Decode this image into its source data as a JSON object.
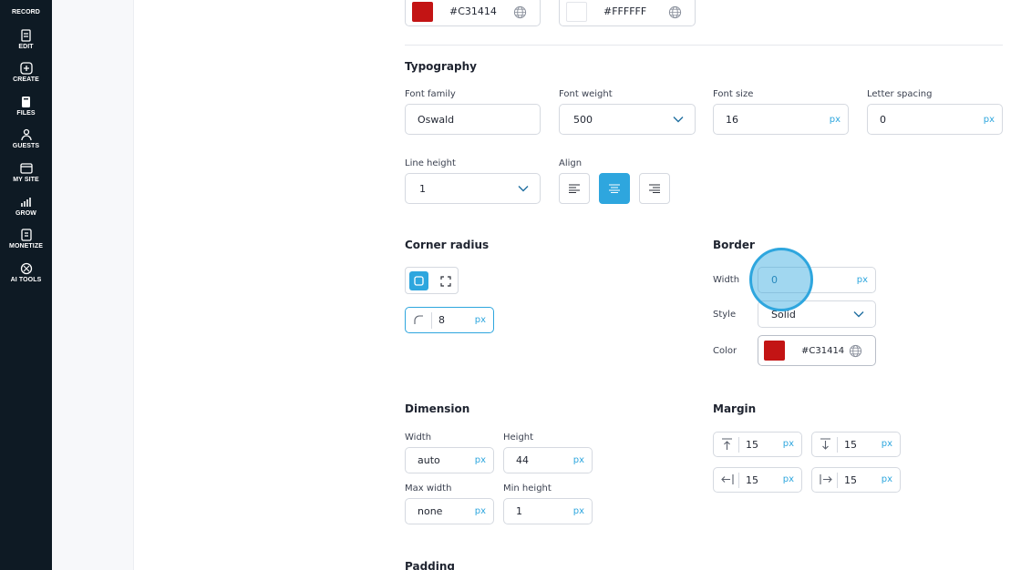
{
  "sidebar": {
    "items": [
      {
        "label": "RECORD",
        "icon": "record-icon"
      },
      {
        "label": "EDIT",
        "icon": "edit-icon"
      },
      {
        "label": "CREATE",
        "icon": "create-icon"
      },
      {
        "label": "FILES",
        "icon": "files-icon"
      },
      {
        "label": "GUESTS",
        "icon": "guests-icon"
      },
      {
        "label": "MY SITE",
        "icon": "my-site-icon"
      },
      {
        "label": "GROW",
        "icon": "grow-icon"
      },
      {
        "label": "MONETIZE",
        "icon": "monetize-icon"
      },
      {
        "label": "AI TOOLS",
        "icon": "ai-tools-icon"
      }
    ]
  },
  "colors": {
    "accent": "#2EA6DE",
    "sidebar_bg": "#0E1A24"
  },
  "top_colors": {
    "first": {
      "hex": "#C31414",
      "swatch": "#C31414"
    },
    "second": {
      "hex": "#FFFFFF",
      "swatch": "#FFFFFF"
    }
  },
  "typography": {
    "title": "Typography",
    "font_family": {
      "label": "Font family",
      "value": "Oswald"
    },
    "font_weight": {
      "label": "Font weight",
      "value": "500"
    },
    "font_size": {
      "label": "Font size",
      "value": "16",
      "unit": "px"
    },
    "letter_spacing": {
      "label": "Letter spacing",
      "value": "0",
      "unit": "px"
    },
    "line_height": {
      "label": "Line height",
      "value": "1"
    },
    "align": {
      "label": "Align",
      "options": [
        "left",
        "center",
        "right"
      ],
      "selected": "center"
    }
  },
  "corner_radius": {
    "title": "Corner radius",
    "value": "8",
    "unit": "px"
  },
  "border": {
    "title": "Border",
    "width": {
      "label": "Width",
      "value": "0",
      "unit": "px"
    },
    "style": {
      "label": "Style",
      "value": "Solid"
    },
    "color": {
      "label": "Color",
      "value": "#C31414",
      "swatch": "#C31414"
    }
  },
  "dimension": {
    "title": "Dimension",
    "width": {
      "label": "Width",
      "value": "auto",
      "unit": "px"
    },
    "height": {
      "label": "Height",
      "value": "44",
      "unit": "px"
    },
    "max_width": {
      "label": "Max width",
      "value": "none",
      "unit": "px"
    },
    "min_height": {
      "label": "Min height",
      "value": "1",
      "unit": "px"
    }
  },
  "margin": {
    "title": "Margin",
    "top": {
      "value": "15",
      "unit": "px"
    },
    "bottom": {
      "value": "15",
      "unit": "px"
    },
    "left": {
      "value": "15",
      "unit": "px"
    },
    "right": {
      "value": "15",
      "unit": "px"
    }
  },
  "padding": {
    "title": "Padding"
  }
}
